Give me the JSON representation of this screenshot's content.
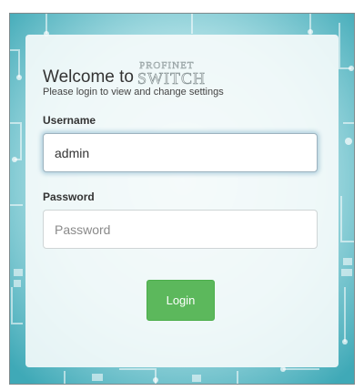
{
  "login": {
    "welcome_text": "Welcome to",
    "logo_line1": "PROFINET",
    "logo_line2": "SWITCH",
    "subtitle": "Please login to view and change settings",
    "username_label": "Username",
    "username_value": "admin",
    "password_label": "Password",
    "password_placeholder": "Password",
    "login_button": "Login"
  },
  "colors": {
    "background_teal": "#55b9c6",
    "button_green": "#5cb85c",
    "card": "#f6fbfb"
  }
}
